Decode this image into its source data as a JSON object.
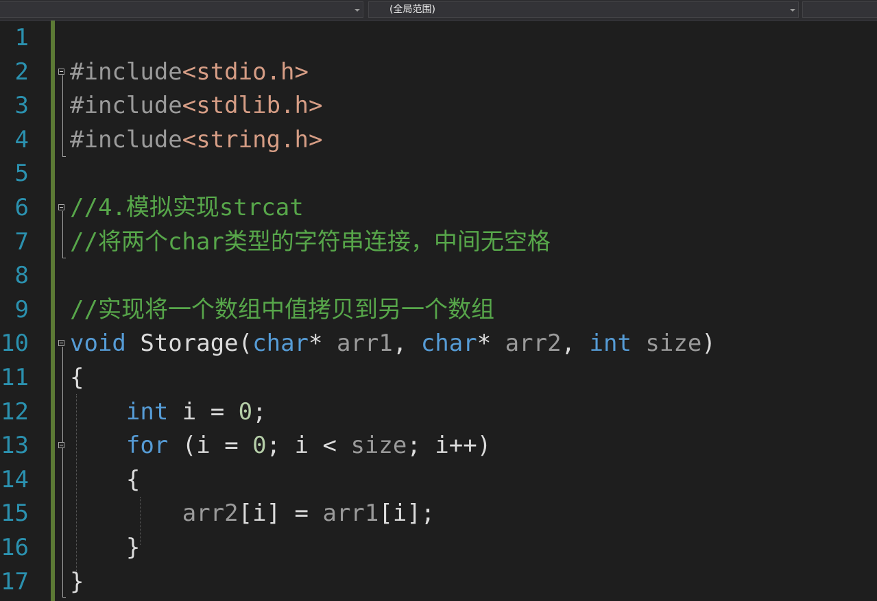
{
  "toolbar": {
    "left_combo_value": "",
    "scope_combo_value": "(全局范围)",
    "right_combo_value": ""
  },
  "line_numbers": [
    "1",
    "2",
    "3",
    "4",
    "5",
    "6",
    "7",
    "8",
    "9",
    "10",
    "11",
    "12",
    "13",
    "14",
    "15",
    "16",
    "17"
  ],
  "code_lines": [
    [],
    [
      {
        "t": "pp",
        "v": "#include"
      },
      {
        "t": "inc",
        "v": "<stdio.h>"
      }
    ],
    [
      {
        "t": "pp",
        "v": "#include"
      },
      {
        "t": "inc",
        "v": "<stdlib.h>"
      }
    ],
    [
      {
        "t": "pp",
        "v": "#include"
      },
      {
        "t": "inc",
        "v": "<string.h>"
      }
    ],
    [],
    [
      {
        "t": "cm",
        "v": "//4.模拟实现strcat"
      }
    ],
    [
      {
        "t": "cm",
        "v": "//将两个char类型的字符串连接，中间无空格"
      }
    ],
    [],
    [
      {
        "t": "cm",
        "v": "//实现将一个数组中值拷贝到另一个数组"
      }
    ],
    [
      {
        "t": "kw",
        "v": "void"
      },
      {
        "t": "fn",
        "v": " Storage("
      },
      {
        "t": "kw",
        "v": "char"
      },
      {
        "t": "fn",
        "v": "* "
      },
      {
        "t": "pm",
        "v": "arr1"
      },
      {
        "t": "fn",
        "v": ", "
      },
      {
        "t": "kw",
        "v": "char"
      },
      {
        "t": "fn",
        "v": "* "
      },
      {
        "t": "pm",
        "v": "arr2"
      },
      {
        "t": "fn",
        "v": ", "
      },
      {
        "t": "kw",
        "v": "int"
      },
      {
        "t": "fn",
        "v": " "
      },
      {
        "t": "pm",
        "v": "size"
      },
      {
        "t": "fn",
        "v": ")"
      }
    ],
    [
      {
        "t": "fn",
        "v": "{"
      }
    ],
    [
      {
        "t": "fn",
        "v": "    "
      },
      {
        "t": "kw",
        "v": "int"
      },
      {
        "t": "fn",
        "v": " i = "
      },
      {
        "t": "num",
        "v": "0"
      },
      {
        "t": "fn",
        "v": ";"
      }
    ],
    [
      {
        "t": "fn",
        "v": "    "
      },
      {
        "t": "kw",
        "v": "for"
      },
      {
        "t": "fn",
        "v": " (i = "
      },
      {
        "t": "num",
        "v": "0"
      },
      {
        "t": "fn",
        "v": "; i < "
      },
      {
        "t": "pm",
        "v": "size"
      },
      {
        "t": "fn",
        "v": "; i++)"
      }
    ],
    [
      {
        "t": "fn",
        "v": "    {"
      }
    ],
    [
      {
        "t": "fn",
        "v": "        "
      },
      {
        "t": "pm",
        "v": "arr2"
      },
      {
        "t": "fn",
        "v": "[i] = "
      },
      {
        "t": "pm",
        "v": "arr1"
      },
      {
        "t": "fn",
        "v": "[i];"
      }
    ],
    [
      {
        "t": "fn",
        "v": "    }"
      }
    ],
    [
      {
        "t": "fn",
        "v": "}"
      }
    ]
  ],
  "colors": {
    "background": "#1e1e1e",
    "line_number": "#2b91af",
    "keyword": "#569cd6",
    "comment": "#57a64a",
    "include_path": "#d69d85",
    "parameter": "#9a9a9a",
    "number": "#b5cea8",
    "change_bar": "#5c7a35"
  }
}
